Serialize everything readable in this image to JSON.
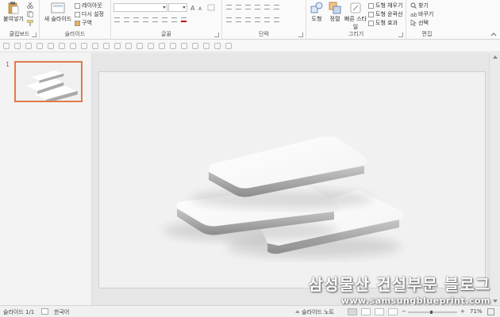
{
  "ribbon": {
    "clipboard": {
      "label": "클립보드",
      "paste_label": "붙여넣기"
    },
    "slides": {
      "label": "슬라이드",
      "new_slide_label": "새 슬라이드",
      "layout_label": "레이아웃",
      "reset_label": "다시 설정",
      "section_label": "구역"
    },
    "font": {
      "label": "글꼴",
      "font_name": "",
      "font_size": ""
    },
    "paragraph": {
      "label": "단락"
    },
    "drawing": {
      "label": "그리기",
      "shapes_label": "도형",
      "arrange_label": "정렬",
      "quick_styles_label": "빠른 스타일",
      "fill_label": "도형 채우기",
      "outline_label": "도형 윤곽선",
      "effects_label": "도형 효과"
    },
    "editing": {
      "label": "편집",
      "find_label": "찾기",
      "replace_label": "바꾸기",
      "select_label": "선택"
    }
  },
  "thumbnails": {
    "slide_number": "1"
  },
  "status": {
    "slide_info": "슬라이드 1/1",
    "language": "한국어",
    "notes_label": "슬라이드 노트",
    "zoom": "71%"
  },
  "watermark": {
    "title": "삼성물산 건설부문 블로그",
    "url": "www.samsungblueprint.com"
  },
  "colors": {
    "accent": "#e07a4a",
    "slide_bg": "#f1f1f1",
    "ribbon_bg": "#fafafa"
  }
}
